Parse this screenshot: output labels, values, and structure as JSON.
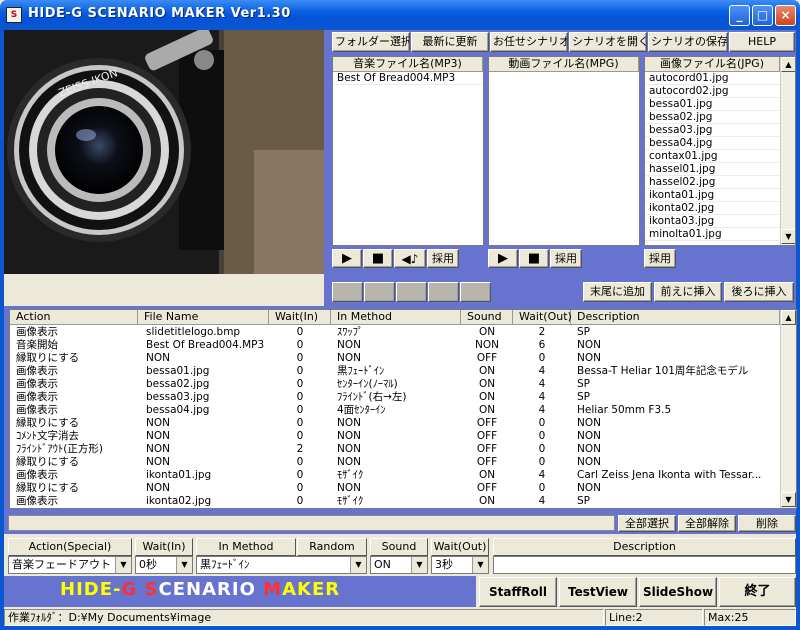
{
  "window": {
    "title": "HIDE-G SCENARIO MAKER Ver1.30",
    "icon_text": "S"
  },
  "toolbar": [
    "フォルダー選択",
    "最新に更新",
    "お任せシナリオ",
    "シナリオを開く",
    "シナリオの保存",
    "HELP"
  ],
  "audio_list": {
    "header": "音楽ファイル名(MP3)",
    "items": [
      "Best Of Bread004.MP3"
    ]
  },
  "video_list": {
    "header": "動画ファイル名(MPG)",
    "items": []
  },
  "image_list": {
    "header": "画像ファイル名(JPG)",
    "items": [
      "autocord01.jpg",
      "autocord02.jpg",
      "bessa01.jpg",
      "bessa02.jpg",
      "bessa03.jpg",
      "bessa04.jpg",
      "contax01.jpg",
      "hassel01.jpg",
      "hassel02.jpg",
      "ikonta01.jpg",
      "ikonta02.jpg",
      "ikonta03.jpg",
      "minolta01.jpg"
    ]
  },
  "media_controls": {
    "adopt": "採用",
    "play_icon": "play-icon",
    "stop_icon": "stop-icon",
    "volume_icon": "volume-icon"
  },
  "insert_buttons": [
    "末尾に追加",
    "前えに挿入",
    "後ろに挿入"
  ],
  "table": {
    "columns": [
      "Action",
      "File Name",
      "Wait(In)",
      "In Method",
      "Sound",
      "Wait(Out)",
      "Description"
    ],
    "rows": [
      [
        "画像表示",
        "slidetitlelogo.bmp",
        "0",
        "ｽﾜｯﾌﾟ",
        "ON",
        "2",
        "SP"
      ],
      [
        "音楽開始",
        "Best Of Bread004.MP3",
        "0",
        "NON",
        "NON",
        "6",
        "NON"
      ],
      [
        "縁取りにする",
        "NON",
        "0",
        "NON",
        "OFF",
        "0",
        "NON"
      ],
      [
        "画像表示",
        "bessa01.jpg",
        "0",
        "黒ﾌｪｰﾄﾞｲﾝ",
        "ON",
        "4",
        "Bessa-T Heliar 101周年記念モデル"
      ],
      [
        "画像表示",
        "bessa02.jpg",
        "0",
        "ｾﾝﾀｰｲﾝ(ﾉｰﾏﾙ)",
        "ON",
        "4",
        "SP"
      ],
      [
        "画像表示",
        "bessa03.jpg",
        "0",
        "ﾌﾗｲﾝﾄﾞ(右→左)",
        "ON",
        "4",
        "SP"
      ],
      [
        "画像表示",
        "bessa04.jpg",
        "0",
        "4面ｾﾝﾀｰｲﾝ",
        "ON",
        "4",
        "Heliar 50mm F3.5"
      ],
      [
        "縁取りにする",
        "NON",
        "0",
        "NON",
        "OFF",
        "0",
        "NON"
      ],
      [
        "ｺﾒﾝﾄ文字消去",
        "NON",
        "0",
        "NON",
        "OFF",
        "0",
        "NON"
      ],
      [
        "ﾌﾗｲﾝﾄﾞｱｳﾄ(正方形)",
        "NON",
        "2",
        "NON",
        "OFF",
        "0",
        "NON"
      ],
      [
        "縁取りにする",
        "NON",
        "0",
        "NON",
        "OFF",
        "0",
        "NON"
      ],
      [
        "画像表示",
        "ikonta01.jpg",
        "0",
        "ﾓｻﾞｲｸ",
        "ON",
        "4",
        "Carl Zeiss Jena Ikonta with Tessar..."
      ],
      [
        "縁取りにする",
        "NON",
        "0",
        "NON",
        "OFF",
        "0",
        "NON"
      ],
      [
        "画像表示",
        "ikonta02.jpg",
        "0",
        "ﾓｻﾞｲｸ",
        "ON",
        "4",
        "SP"
      ]
    ]
  },
  "table_actions": [
    "全部選択",
    "全部解除",
    "削除"
  ],
  "editor": {
    "headers": [
      "Action(Special)",
      "Wait(In)",
      "In Method",
      "Random",
      "Sound",
      "Wait(Out)",
      "Description"
    ],
    "action": "音楽フェードアウト",
    "wait_in": "0秒",
    "in_method": "黒ﾌｪｰﾄﾞｲﾝ",
    "sound": "ON",
    "wait_out": "3秒",
    "description": ""
  },
  "logo": {
    "parts": [
      "HIDE-",
      "G",
      " ",
      "S",
      "CENARIO ",
      "M",
      "AKER"
    ]
  },
  "bottom_buttons": [
    "StaffRoll",
    "TestView",
    "SlideShow",
    "終了"
  ],
  "status": {
    "folder": "作業ﾌｫﾙﾀﾞ：D:¥My Documents¥image",
    "line": "Line:2",
    "max": "Max:25"
  },
  "colors": {
    "accent_blue": "#0b57d0",
    "panel_blue": "#6674d0",
    "logo_yellow": "#ffff00",
    "logo_red": "#ff3030"
  }
}
